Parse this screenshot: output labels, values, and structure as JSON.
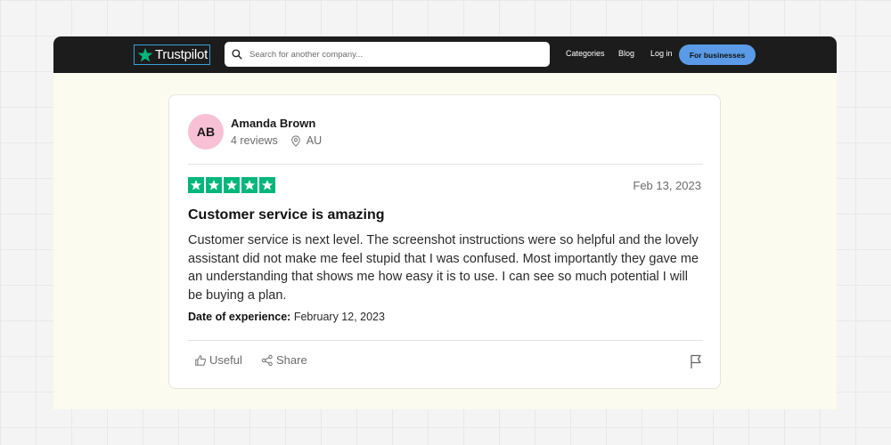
{
  "nav": {
    "logo_text": "Trustpilot",
    "search_placeholder": "Search for another company...",
    "links": [
      "Categories",
      "Blog",
      "Log in"
    ],
    "business_button": "For businesses"
  },
  "review": {
    "avatar_initials": "AB",
    "reviewer_name": "Amanda Brown",
    "reviews_count": "4 reviews",
    "location": "AU",
    "rating": 5,
    "date": "Feb 13, 2023",
    "title": "Customer service is amazing",
    "body": "Customer service is next level. The screenshot instructions were so helpful and the lovely assistant did not make me feel stupid that I was confused. Most importantly they gave me an understanding that shows me how easy it is to use. I can see so much potential I will be buying a plan.",
    "experience_label": "Date of experience:",
    "experience_date": "February 12, 2023",
    "useful_label": "Useful",
    "share_label": "Share"
  },
  "colors": {
    "brand_green": "#00b67a",
    "nav_bg": "#1c1c1c",
    "business_button": "#5b9ae6",
    "avatar_bg": "#f7c0d4"
  },
  "icons": [
    "trustpilot-star-icon",
    "search-icon",
    "location-pin-icon",
    "star-icon",
    "thumbs-up-icon",
    "share-icon",
    "flag-icon"
  ]
}
